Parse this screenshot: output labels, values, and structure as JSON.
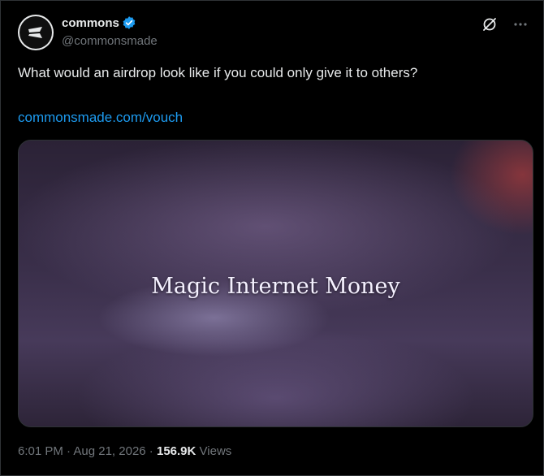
{
  "author": {
    "display_name": "commons",
    "handle": "@commonsmade",
    "verified": true,
    "avatar_icon": "commons-logo-icon"
  },
  "top_icons": [
    "grok-icon",
    "more-options-icon"
  ],
  "tweet": {
    "text": "What would an airdrop look like if you could only give it to others?",
    "link": "commonsmade.com/vouch"
  },
  "media": {
    "caption": "Magic Internet Money"
  },
  "meta": {
    "time": "6:01 PM",
    "separator": " · ",
    "date": "Aug 21, 2026",
    "views_count": "156.9K",
    "views_label": "Views"
  },
  "colors": {
    "background": "#000000",
    "text": "#e7e9ea",
    "muted": "#71767b",
    "link": "#1d9bf0",
    "verified": "#1d9bf0",
    "border": "#2f3336"
  }
}
